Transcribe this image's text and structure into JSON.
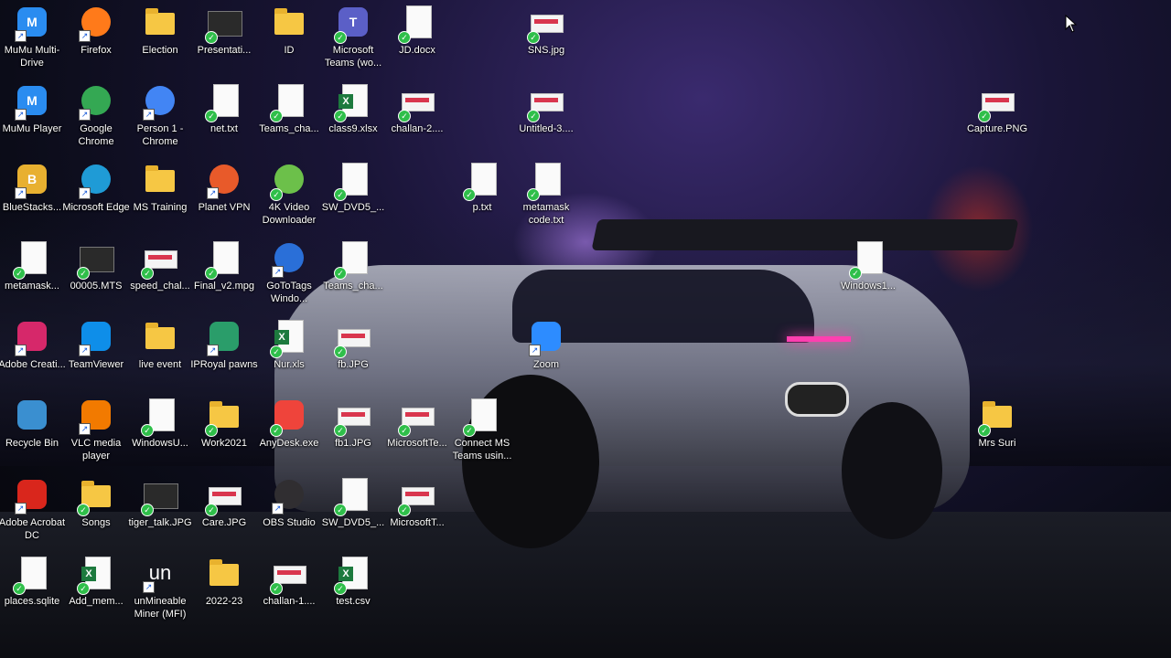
{
  "desktop": {
    "icons": [
      {
        "label": "MuMu Multi-Drive",
        "icon": "mumu-multidrive-icon",
        "type": "app",
        "color": "#2a8cf0",
        "sym": "M",
        "shortcut": true
      },
      {
        "label": "Firefox",
        "icon": "firefox-icon",
        "type": "round",
        "color": "#ff7a1a",
        "sym": "",
        "shortcut": true
      },
      {
        "label": "Election",
        "icon": "folder-icon",
        "type": "folder"
      },
      {
        "label": "Presentati...",
        "icon": "video-file-icon",
        "type": "video",
        "check": true
      },
      {
        "label": "ID",
        "icon": "folder-icon",
        "type": "folder"
      },
      {
        "label": "Microsoft Teams (wo...",
        "icon": "teams-icon",
        "type": "app",
        "color": "#5b5fc7",
        "sym": "T",
        "check": true
      },
      {
        "label": "JD.docx",
        "icon": "document-icon",
        "type": "doc",
        "check": true
      },
      {
        "label": "SNS.jpg",
        "icon": "image-file-icon",
        "type": "img",
        "check": true
      },
      {
        "label": "MuMu Player",
        "icon": "mumu-player-icon",
        "type": "app",
        "color": "#2a8cf0",
        "sym": "M",
        "shortcut": true
      },
      {
        "label": "Google Chrome",
        "icon": "chrome-icon",
        "type": "round",
        "color": "#34a853",
        "sym": "",
        "shortcut": true
      },
      {
        "label": "Person 1 - Chrome",
        "icon": "chrome-profile-icon",
        "type": "round",
        "color": "#4285f4",
        "sym": "",
        "shortcut": true
      },
      {
        "label": "net.txt",
        "icon": "text-file-icon",
        "type": "doc",
        "check": true
      },
      {
        "label": "Teams_cha...",
        "icon": "text-file-icon",
        "type": "doc",
        "check": true
      },
      {
        "label": "class9.xlsx",
        "icon": "excel-file-icon",
        "type": "xls",
        "check": true
      },
      {
        "label": "challan-2....",
        "icon": "image-file-icon",
        "type": "img",
        "check": true
      },
      {
        "label": "Untitled-3....",
        "icon": "image-file-icon",
        "type": "img",
        "check": true
      },
      {
        "label": "Capture.PNG",
        "icon": "image-file-icon",
        "type": "img",
        "check": true
      },
      {
        "label": "BlueStacks...",
        "icon": "bluestacks-icon",
        "type": "app",
        "color": "#e8b030",
        "sym": "B",
        "shortcut": true
      },
      {
        "label": "Microsoft Edge",
        "icon": "edge-icon",
        "type": "round",
        "color": "#1f9bd6",
        "sym": "",
        "shortcut": true
      },
      {
        "label": "MS Training",
        "icon": "folder-icon",
        "type": "folder"
      },
      {
        "label": "Planet VPN",
        "icon": "planet-vpn-icon",
        "type": "round",
        "color": "#e85a2a",
        "sym": "",
        "shortcut": true
      },
      {
        "label": "4K Video Downloader",
        "icon": "4k-video-downloader-icon",
        "type": "round",
        "color": "#6cc04a",
        "sym": "",
        "check": true
      },
      {
        "label": "SW_DVD5_...",
        "icon": "disc-image-icon",
        "type": "doc",
        "check": true
      },
      {
        "label": "p.txt",
        "icon": "text-file-icon",
        "type": "doc",
        "check": true
      },
      {
        "label": "metamask code.txt",
        "icon": "text-file-icon",
        "type": "doc",
        "check": true
      },
      {
        "label": "metamask...",
        "icon": "text-file-icon",
        "type": "doc",
        "check": true
      },
      {
        "label": "00005.MTS",
        "icon": "video-file-icon",
        "type": "video",
        "check": true
      },
      {
        "label": "speed_chal...",
        "icon": "image-file-icon",
        "type": "img",
        "check": true
      },
      {
        "label": "Final_v2.mpg",
        "icon": "video-file-icon",
        "type": "doc",
        "check": true
      },
      {
        "label": "GoToTags Windo...",
        "icon": "gototags-icon",
        "type": "round",
        "color": "#2a6fd8",
        "sym": "",
        "shortcut": true
      },
      {
        "label": "Teams_cha...",
        "icon": "text-file-icon",
        "type": "doc",
        "check": true
      },
      {
        "label": "Windows1...",
        "icon": "disc-image-icon",
        "type": "doc",
        "check": true
      },
      {
        "label": "Adobe Creati...",
        "icon": "adobe-cc-icon",
        "type": "app",
        "color": "#d6286a",
        "sym": "",
        "shortcut": true
      },
      {
        "label": "TeamViewer",
        "icon": "teamviewer-icon",
        "type": "app",
        "color": "#0e8ee9",
        "sym": "",
        "shortcut": true
      },
      {
        "label": "live event",
        "icon": "folder-icon",
        "type": "folder"
      },
      {
        "label": "IPRoyal pawns",
        "icon": "iproyal-pawns-icon",
        "type": "app",
        "color": "#2a9d6a",
        "sym": "",
        "shortcut": true
      },
      {
        "label": "Nur.xls",
        "icon": "excel-file-icon",
        "type": "xls",
        "check": true
      },
      {
        "label": "fb.JPG",
        "icon": "image-file-icon",
        "type": "img",
        "check": true
      },
      {
        "label": "Zoom",
        "icon": "zoom-icon",
        "type": "app",
        "color": "#2d8cff",
        "sym": "",
        "shortcut": true
      },
      {
        "label": "Recycle Bin",
        "icon": "recycle-bin-icon",
        "type": "app",
        "color": "#3a8fd0",
        "sym": ""
      },
      {
        "label": "VLC media player",
        "icon": "vlc-icon",
        "type": "app",
        "color": "#f27a00",
        "sym": "",
        "shortcut": true
      },
      {
        "label": "WindowsU...",
        "icon": "disc-image-icon",
        "type": "doc",
        "check": true
      },
      {
        "label": "Work2021",
        "icon": "folder-icon",
        "type": "folder",
        "check": true
      },
      {
        "label": "AnyDesk.exe",
        "icon": "anydesk-icon",
        "type": "app",
        "color": "#ef443b",
        "sym": "",
        "check": true
      },
      {
        "label": "fb1.JPG",
        "icon": "image-file-icon",
        "type": "img",
        "check": true
      },
      {
        "label": "MicrosoftTe...",
        "icon": "image-file-icon",
        "type": "img",
        "check": true
      },
      {
        "label": "Connect MS Teams usin...",
        "icon": "text-file-icon",
        "type": "doc",
        "check": true
      },
      {
        "label": "Mrs Suri",
        "icon": "folder-icon",
        "type": "folder",
        "check": true
      },
      {
        "label": "Adobe Acrobat DC",
        "icon": "acrobat-icon",
        "type": "app",
        "color": "#d9261c",
        "sym": "",
        "shortcut": true
      },
      {
        "label": "Songs",
        "icon": "folder-icon",
        "type": "folder",
        "check": true
      },
      {
        "label": "tiger_talk.JPG",
        "icon": "image-file-icon",
        "type": "video",
        "check": true
      },
      {
        "label": "Care.JPG",
        "icon": "image-file-icon",
        "type": "img",
        "check": true
      },
      {
        "label": "OBS Studio",
        "icon": "obs-icon",
        "type": "round",
        "color": "#302e31",
        "sym": "",
        "shortcut": true
      },
      {
        "label": "SW_DVD5_...",
        "icon": "disc-image-icon",
        "type": "doc",
        "check": true
      },
      {
        "label": "MicrosoftT...",
        "icon": "image-file-icon",
        "type": "img",
        "check": true
      },
      {
        "label": "places.sqlite",
        "icon": "database-file-icon",
        "type": "doc",
        "check": true
      },
      {
        "label": "Add_mem...",
        "icon": "excel-file-icon",
        "type": "xls",
        "check": true
      },
      {
        "label": "unMineable Miner (MFI)",
        "icon": "unmineable-icon",
        "type": "text",
        "color": "#1a1a1a",
        "sym": "un",
        "shortcut": true
      },
      {
        "label": "2022-23",
        "icon": "folder-icon",
        "type": "folder"
      },
      {
        "label": "challan-1....",
        "icon": "image-file-icon",
        "type": "img",
        "check": true
      },
      {
        "label": "test.csv",
        "icon": "excel-file-icon",
        "type": "xls",
        "check": true
      }
    ]
  }
}
